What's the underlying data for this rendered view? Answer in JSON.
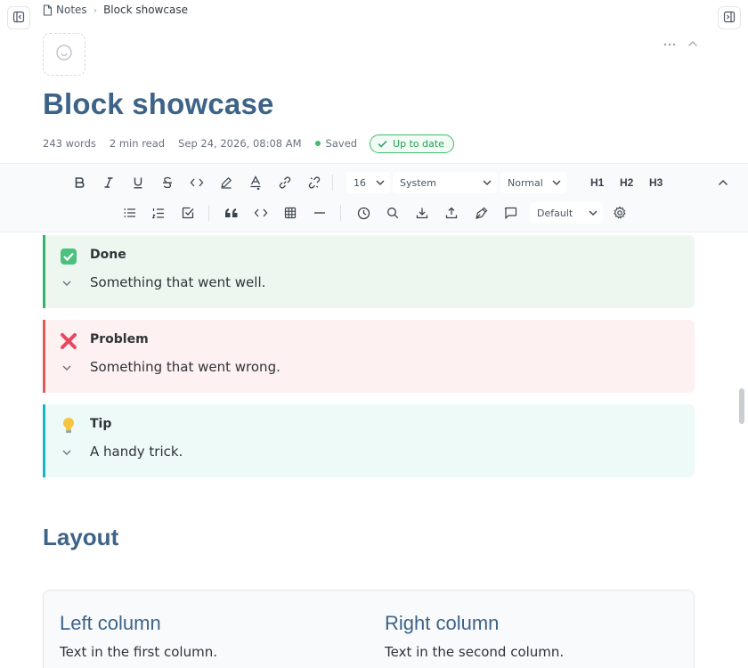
{
  "breadcrumb": {
    "root": "Notes",
    "current": "Block showcase"
  },
  "page": {
    "title": "Block showcase",
    "meta": {
      "words": "243 words",
      "read_time": "2 min read",
      "date": "Sep 24, 2026, 08:08 AM",
      "saved": "Saved",
      "sync_status": "Up to date"
    }
  },
  "toolbar": {
    "font_size": "16",
    "font_family": "System",
    "block_style": "Normal",
    "h1": "H1",
    "h2": "H2",
    "h3": "H3",
    "theme": "Default"
  },
  "callouts": [
    {
      "title": "Done",
      "body": "Something that went well.",
      "icon": "check-box-emoji",
      "accent": "#37b26b"
    },
    {
      "title": "Problem",
      "body": "Something that went wrong.",
      "icon": "cross-mark-emoji",
      "accent": "#e05a5a"
    },
    {
      "title": "Tip",
      "body": "A handy trick.",
      "icon": "light-bulb-emoji",
      "accent": "#17b6c4"
    }
  ],
  "layout_section": {
    "heading": "Layout",
    "columns": [
      {
        "heading": "Left column",
        "text": "Text in the first column."
      },
      {
        "heading": "Right column",
        "text": "Text in the second column."
      }
    ]
  },
  "colors": {
    "heading": "#3d6388",
    "saved_green": "#3cbf6a"
  }
}
